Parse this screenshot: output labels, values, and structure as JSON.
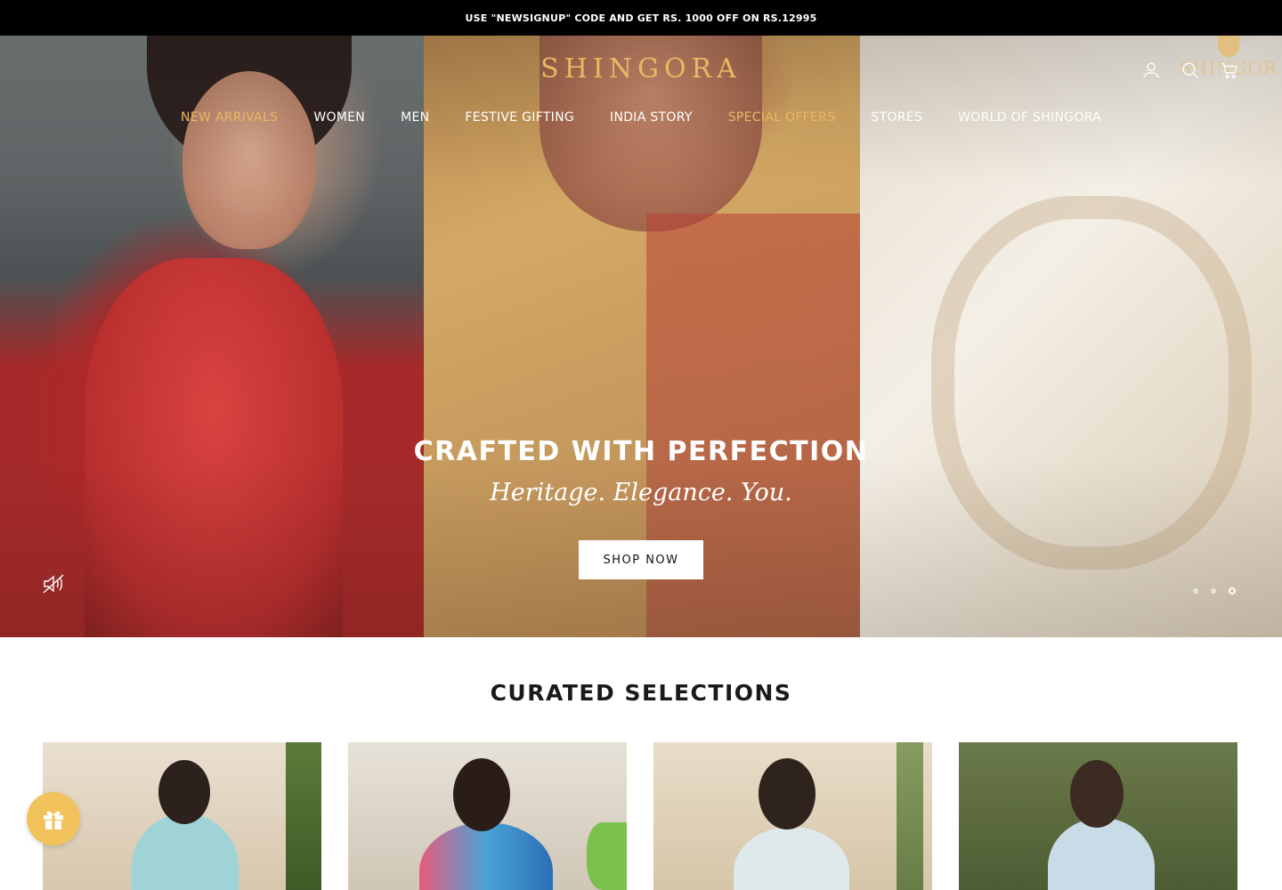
{
  "announcement": {
    "text": "USE \"NEWSIGNUP\" CODE AND GET RS. 1000 OFF ON RS.12995"
  },
  "header": {
    "logo": "SHINGORA",
    "watermark": "SHINGORA",
    "icons": [
      "user-icon",
      "search-icon",
      "cart-icon"
    ]
  },
  "nav": {
    "items": [
      {
        "label": "NEW ARRIVALS",
        "accent": true
      },
      {
        "label": "WOMEN",
        "accent": false
      },
      {
        "label": "MEN",
        "accent": false
      },
      {
        "label": "FESTIVE GIFTING",
        "accent": false
      },
      {
        "label": "INDIA STORY",
        "accent": false
      },
      {
        "label": "SPECIAL OFFERS",
        "accent": true
      },
      {
        "label": "STORES",
        "accent": false
      },
      {
        "label": "WORLD OF SHINGORA",
        "accent": false
      }
    ]
  },
  "hero": {
    "title": "CRAFTED WITH PERFECTION",
    "subtitle": "Heritage. Elegance. You.",
    "cta_label": "SHOP NOW",
    "slide_count": 3,
    "active_slide": 3
  },
  "curated": {
    "title": "CURATED SELECTIONS"
  },
  "colors": {
    "accent_gold": "#e9b862",
    "announcement_bg": "#000000",
    "gift_button": "#f2c25c"
  }
}
